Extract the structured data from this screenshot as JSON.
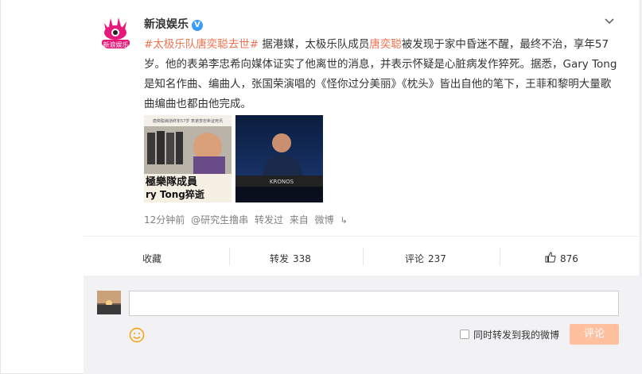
{
  "post": {
    "username": "新浪娱乐",
    "verified_mark": "V",
    "text_parts": {
      "topic": "#太极乐队唐奕聪去世#",
      "p1": " 据港媒，太极乐队成员",
      "mention": "唐奕聪",
      "p2": "被发现于家中昏迷不醒，最终不治，享年57岁。他的表弟李忠希向媒体证实了他离世的消息，并表示怀疑是心脏病发作猝死。据悉，Gary Tong是知名作曲、编曲人，张国荣演唱的《怪你过分美丽》《枕头》皆出自他的笔下，王菲和黎明大量歌曲编曲也都由他完成。"
    },
    "image1_caption_top": "唐奕聪病逝终年57岁 表弟李忠希证死讯",
    "image1_caption_a": "極樂隊成員",
    "image1_caption_b": "ry Tong猝逝",
    "image2_keyboard": "KRONOS"
  },
  "meta": {
    "time": "12分钟前",
    "via": "@研究生撸串",
    "repost": "转发过",
    "from": "来自",
    "app": "微博",
    "app_icon": "link-icon"
  },
  "actions": {
    "fav": "收藏",
    "repost_label": "转发",
    "repost_count": "338",
    "comment_label": "评论",
    "comment_count": "237",
    "like_count": "876"
  },
  "comment_box": {
    "placeholder": "",
    "sync_label": "同时转发到我的微博",
    "submit_label": "评论"
  },
  "colors": {
    "accent": "#eb7350",
    "link": "#eb7350",
    "submit_disabled": "#ffc09f",
    "verified": "#3b9cff"
  }
}
